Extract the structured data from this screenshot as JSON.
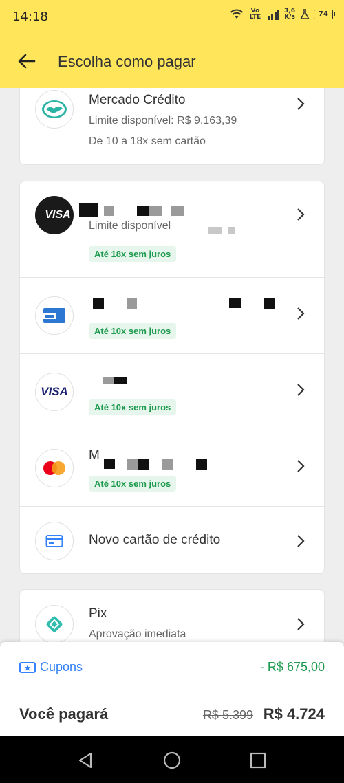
{
  "status_bar": {
    "time": "14:18",
    "network": "Vo LTE",
    "speed_value": "3,6",
    "speed_unit": "K/s",
    "battery": "74"
  },
  "header": {
    "title": "Escolha como pagar",
    "back_icon": "arrow-left-icon"
  },
  "colors": {
    "brand_yellow": "#fee55a",
    "accent_blue": "#3483fa",
    "success_green": "#1c9a4d"
  },
  "payment_methods": {
    "mercado_credito": {
      "title": "Mercado Crédito",
      "limit": "Limite disponível: R$ 9.163,39",
      "installments": "De 10 a 18x sem cartão",
      "icon": "handshake-icon"
    },
    "cards": [
      {
        "brand": "VISA",
        "subtitle": "Limite disponível",
        "badge": "Até 18x sem juros",
        "icon": "visa-dark-icon"
      },
      {
        "badge": "Até 10x sem juros",
        "icon": "amex-icon"
      },
      {
        "brand": "VISA",
        "badge": "Até 10x sem juros",
        "icon": "visa-icon"
      },
      {
        "title_initial": "M",
        "badge": "Até 10x sem juros",
        "icon": "mastercard-icon"
      }
    ],
    "new_card": {
      "label": "Novo cartão de crédito",
      "icon": "credit-card-icon"
    },
    "pix": {
      "title": "Pix",
      "subtitle": "Aprovação imediata",
      "icon": "pix-icon"
    }
  },
  "summary": {
    "coupons_label": "Cupons",
    "coupons_value": "- R$ 675,00",
    "you_pay_label": "Você pagará",
    "old_price": "R$ 5.399",
    "new_price": "R$ 4.724"
  },
  "navigation": {
    "back": "nav-back-icon",
    "home": "nav-home-icon",
    "recents": "nav-recents-icon"
  }
}
